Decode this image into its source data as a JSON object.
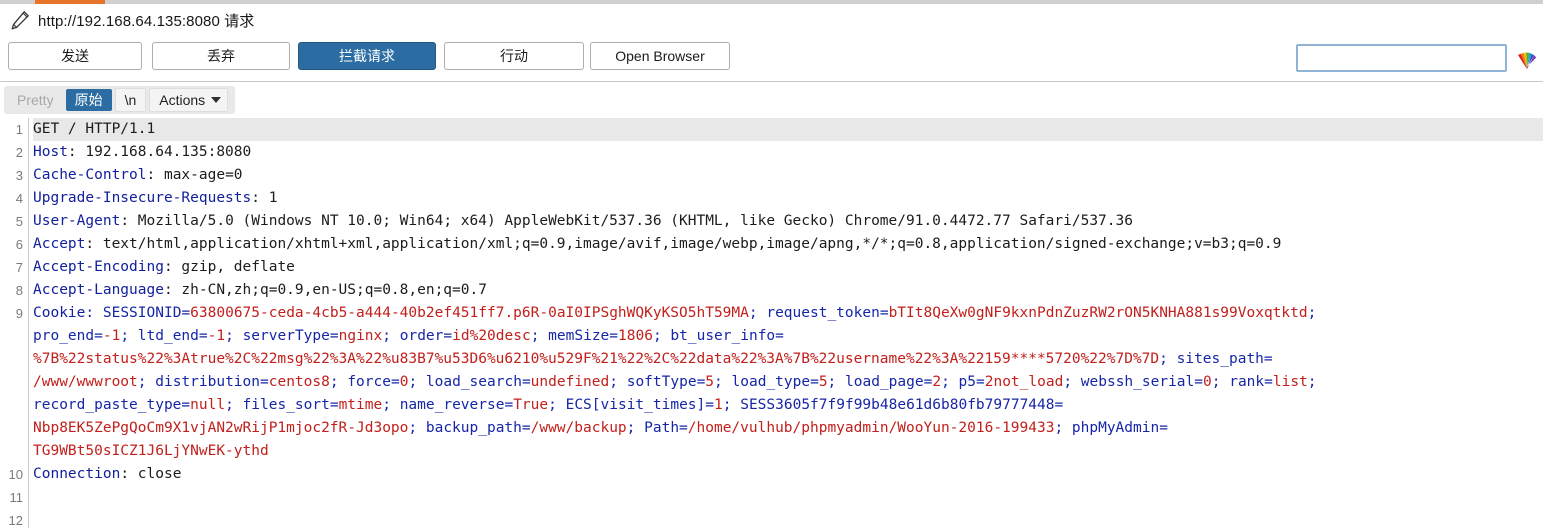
{
  "window": {
    "accent_color": "#e8742c",
    "title": "http://192.168.64.135:8080 请求",
    "title_icon": "pencil-icon"
  },
  "toolbar": {
    "send_label": "发送",
    "drop_label": "丢弃",
    "intercept_label": "拦截请求",
    "action_label": "行动",
    "open_browser_label": "Open Browser",
    "intercept_active": true,
    "primary_color": "#2b6ca3",
    "search": {
      "value": "",
      "placeholder": ""
    },
    "palette_icon": "color-palette-icon"
  },
  "view_bar": {
    "pretty_label": "Pretty",
    "raw_label": "原始",
    "newline_label": "\\n",
    "actions_label": "Actions",
    "selected": "原始"
  },
  "editor": {
    "line_numbers": [
      "1",
      "2",
      "3",
      "4",
      "5",
      "6",
      "7",
      "8",
      "9",
      "",
      "",
      "",
      "",
      "",
      "10",
      "11",
      "12"
    ],
    "highlight_line_index": 0,
    "lines": [
      {
        "header": "GET / HTTP/1.1",
        "value": "",
        "style": "plain-hl"
      },
      {
        "header": "Host",
        "value": ": 192.168.64.135:8080",
        "style": "header"
      },
      {
        "header": "Cache-Control",
        "value": ": max-age=0",
        "style": "header"
      },
      {
        "header": "Upgrade-Insecure-Requests",
        "value": ": 1",
        "style": "header"
      },
      {
        "header": "User-Agent",
        "value": ": Mozilla/5.0 (Windows NT 10.0; Win64; x64) AppleWebKit/537.36 (KHTML, like Gecko) Chrome/91.0.4472.77 Safari/537.36",
        "style": "header"
      },
      {
        "header": "Accept",
        "value": ": text/html,application/xhtml+xml,application/xml;q=0.9,image/avif,image/webp,image/apng,*/*;q=0.8,application/signed-exchange;v=b3;q=0.9",
        "style": "header"
      },
      {
        "header": "Accept-Encoding",
        "value": ": gzip, deflate",
        "style": "header"
      },
      {
        "header": "Accept-Language",
        "value": ": zh-CN,zh;q=0.9,en-US;q=0.8,en;q=0.7",
        "style": "header"
      },
      {
        "header": "Cookie",
        "value": ": ",
        "style": "cookie-start"
      },
      {
        "header": "Connection",
        "value": ": close",
        "style": "header"
      }
    ],
    "cookie_tokens": [
      {
        "t": "SESSIONID",
        "c": "key"
      },
      {
        "t": "=",
        "c": "key"
      },
      {
        "t": "63800675-ceda-4cb5-a444-40b2ef451ff7.p6R-0aI0IPSghWQKyKSO5hT59MA",
        "c": "red"
      },
      {
        "t": "; ",
        "c": "key"
      },
      {
        "t": "request_token",
        "c": "key"
      },
      {
        "t": "=",
        "c": "key"
      },
      {
        "t": "bTIt8QeXw0gNF9kxnPdnZuzRW2rON5KNHA881s99Voxqtktd",
        "c": "red"
      },
      {
        "t": ";",
        "c": "key"
      },
      {
        "t": "\n",
        "c": "br"
      },
      {
        "t": "pro_end",
        "c": "key"
      },
      {
        "t": "=",
        "c": "key"
      },
      {
        "t": "-1",
        "c": "red"
      },
      {
        "t": "; ",
        "c": "key"
      },
      {
        "t": "ltd_end",
        "c": "key"
      },
      {
        "t": "=",
        "c": "key"
      },
      {
        "t": "-1",
        "c": "red"
      },
      {
        "t": "; ",
        "c": "key"
      },
      {
        "t": "serverType",
        "c": "key"
      },
      {
        "t": "=",
        "c": "key"
      },
      {
        "t": "nginx",
        "c": "red"
      },
      {
        "t": "; ",
        "c": "key"
      },
      {
        "t": "order",
        "c": "key"
      },
      {
        "t": "=",
        "c": "key"
      },
      {
        "t": "id%20desc",
        "c": "red"
      },
      {
        "t": "; ",
        "c": "key"
      },
      {
        "t": "memSize",
        "c": "key"
      },
      {
        "t": "=",
        "c": "key"
      },
      {
        "t": "1806",
        "c": "red"
      },
      {
        "t": "; ",
        "c": "key"
      },
      {
        "t": "bt_user_info",
        "c": "key"
      },
      {
        "t": "=",
        "c": "key"
      },
      {
        "t": "\n",
        "c": "br"
      },
      {
        "t": "%7B%22status%22%3Atrue%2C%22msg%22%3A%22%u83B7%u53D6%u6210%u529F%21%22%2C%22data%22%3A%7B%22username%22%3A%22159****5720%22%7D%7D",
        "c": "red"
      },
      {
        "t": "; ",
        "c": "key"
      },
      {
        "t": "sites_path",
        "c": "key"
      },
      {
        "t": "=",
        "c": "key"
      },
      {
        "t": "\n",
        "c": "br"
      },
      {
        "t": "/www/wwwroot",
        "c": "red"
      },
      {
        "t": "; ",
        "c": "key"
      },
      {
        "t": "distribution",
        "c": "key"
      },
      {
        "t": "=",
        "c": "key"
      },
      {
        "t": "centos8",
        "c": "red"
      },
      {
        "t": "; ",
        "c": "key"
      },
      {
        "t": "force",
        "c": "key"
      },
      {
        "t": "=",
        "c": "key"
      },
      {
        "t": "0",
        "c": "red"
      },
      {
        "t": "; ",
        "c": "key"
      },
      {
        "t": "load_search",
        "c": "key"
      },
      {
        "t": "=",
        "c": "key"
      },
      {
        "t": "undefined",
        "c": "red"
      },
      {
        "t": "; ",
        "c": "key"
      },
      {
        "t": "softType",
        "c": "key"
      },
      {
        "t": "=",
        "c": "key"
      },
      {
        "t": "5",
        "c": "red"
      },
      {
        "t": "; ",
        "c": "key"
      },
      {
        "t": "load_type",
        "c": "key"
      },
      {
        "t": "=",
        "c": "key"
      },
      {
        "t": "5",
        "c": "red"
      },
      {
        "t": "; ",
        "c": "key"
      },
      {
        "t": "load_page",
        "c": "key"
      },
      {
        "t": "=",
        "c": "key"
      },
      {
        "t": "2",
        "c": "red"
      },
      {
        "t": "; ",
        "c": "key"
      },
      {
        "t": "p5",
        "c": "key"
      },
      {
        "t": "=",
        "c": "key"
      },
      {
        "t": "2not_load",
        "c": "red"
      },
      {
        "t": "; ",
        "c": "key"
      },
      {
        "t": "webssh_serial",
        "c": "key"
      },
      {
        "t": "=",
        "c": "key"
      },
      {
        "t": "0",
        "c": "red"
      },
      {
        "t": "; ",
        "c": "key"
      },
      {
        "t": "rank",
        "c": "key"
      },
      {
        "t": "=",
        "c": "key"
      },
      {
        "t": "list",
        "c": "red"
      },
      {
        "t": ";",
        "c": "key"
      },
      {
        "t": "\n",
        "c": "br"
      },
      {
        "t": "record_paste_type",
        "c": "key"
      },
      {
        "t": "=",
        "c": "key"
      },
      {
        "t": "null",
        "c": "red"
      },
      {
        "t": "; ",
        "c": "key"
      },
      {
        "t": "files_sort",
        "c": "key"
      },
      {
        "t": "=",
        "c": "key"
      },
      {
        "t": "mtime",
        "c": "red"
      },
      {
        "t": "; ",
        "c": "key"
      },
      {
        "t": "name_reverse",
        "c": "key"
      },
      {
        "t": "=",
        "c": "key"
      },
      {
        "t": "True",
        "c": "red"
      },
      {
        "t": "; ",
        "c": "key"
      },
      {
        "t": "ECS[visit_times]",
        "c": "key"
      },
      {
        "t": "=",
        "c": "key"
      },
      {
        "t": "1",
        "c": "red"
      },
      {
        "t": "; ",
        "c": "key"
      },
      {
        "t": "SESS3605f7f9f99b48e61d6b80fb79777448",
        "c": "key"
      },
      {
        "t": "=",
        "c": "key"
      },
      {
        "t": "\n",
        "c": "br"
      },
      {
        "t": "Nbp8EK5ZePgQoCm9X1vjAN2wRijP1mjoc2fR-Jd3opo",
        "c": "red"
      },
      {
        "t": "; ",
        "c": "key"
      },
      {
        "t": "backup_path",
        "c": "key"
      },
      {
        "t": "=",
        "c": "key"
      },
      {
        "t": "/www/backup",
        "c": "red"
      },
      {
        "t": "; ",
        "c": "key"
      },
      {
        "t": "Path",
        "c": "key"
      },
      {
        "t": "=",
        "c": "key"
      },
      {
        "t": "/home/vulhub/phpmyadmin/WooYun-2016-199433",
        "c": "red"
      },
      {
        "t": "; ",
        "c": "key"
      },
      {
        "t": "phpMyAdmin",
        "c": "key"
      },
      {
        "t": "=",
        "c": "key"
      },
      {
        "t": "\n",
        "c": "br"
      },
      {
        "t": "TG9WBt50sICZ1J6LjYNwEK-ythd",
        "c": "red"
      }
    ]
  }
}
